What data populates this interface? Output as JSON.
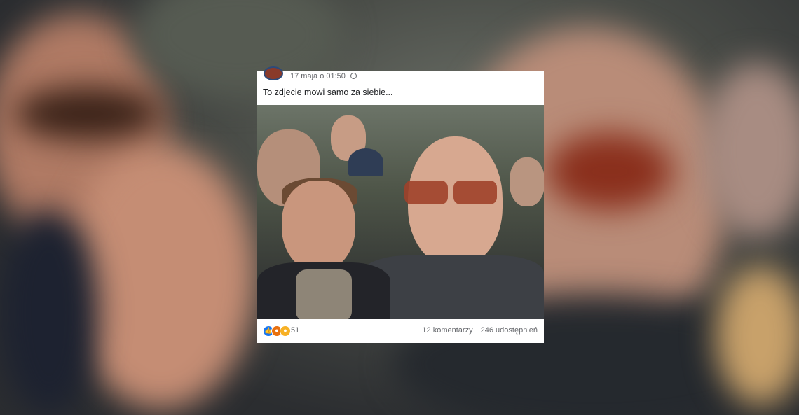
{
  "post": {
    "timestamp": "17 maja o 01:50",
    "privacy_icon": "globe-icon",
    "caption": "To zdjecie mowi samo za siebie...",
    "reactions": {
      "icons": [
        "like-icon",
        "angry-icon",
        "haha-icon"
      ],
      "count": "51"
    },
    "comments": "12 komentarzy",
    "shares": "246 udostępnień"
  },
  "colors": {
    "like": "#1877f2",
    "angry": "#e9710f",
    "haha": "#f7b125",
    "meta_text": "#65676b"
  }
}
